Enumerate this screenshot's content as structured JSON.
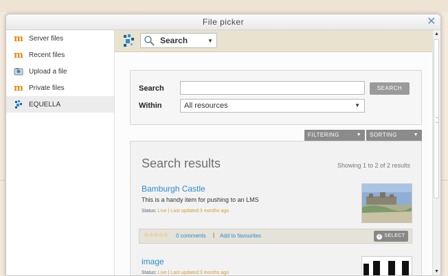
{
  "dialog": {
    "title": "File picker"
  },
  "sidebar": {
    "items": [
      {
        "label": "Server files",
        "icon": "moodle-icon"
      },
      {
        "label": "Recent files",
        "icon": "moodle-icon"
      },
      {
        "label": "Upload a file",
        "icon": "upload-icon"
      },
      {
        "label": "Private files",
        "icon": "moodle-icon"
      },
      {
        "label": "EQUELLA",
        "icon": "equella-icon",
        "active": true
      }
    ]
  },
  "toolbar": {
    "mode_label": "Search"
  },
  "search": {
    "search_label": "Search",
    "search_value": "",
    "search_button": "SEARCH",
    "within_label": "Within",
    "within_value": "All resources"
  },
  "controls": {
    "filtering": "FILTERING",
    "sorting": "SORTING"
  },
  "results": {
    "title": "Search results",
    "count_text": "Showing 1 to 2 of 2 results",
    "items": [
      {
        "title": "Bamburgh Castle",
        "description": "This is a handy item for pushing to an LMS",
        "status_prefix": "Status:",
        "status_value": "Live",
        "updated_text": "| Last updated:3 months ago",
        "comments": "0 comments",
        "separator": "|",
        "favourite": "Add to favourites",
        "select": "SELECT"
      },
      {
        "title": "image",
        "status_prefix": "Status:",
        "status_value": "Live",
        "updated_text": "| Last updated:3 months ago"
      }
    ]
  },
  "colors": {
    "accent": "#2b8ccf",
    "status": "#d2a038",
    "toolbar": "#e8e3cf"
  }
}
